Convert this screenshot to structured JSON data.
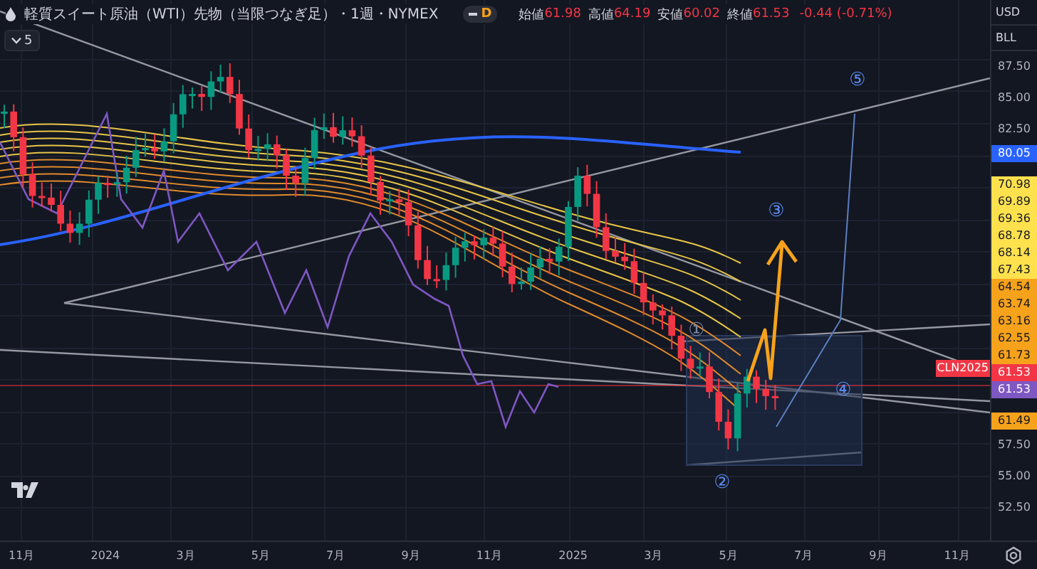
{
  "header": {
    "title": "軽質スイート原油（WTI）先物（当限つなぎ足）・1週・NYMEX",
    "mode_badge": "D",
    "ohlc": [
      {
        "label": "始値",
        "value": "61.98"
      },
      {
        "label": "高値",
        "value": "64.19"
      },
      {
        "label": "安値",
        "value": "60.02"
      },
      {
        "label": "終値",
        "value": "61.53"
      }
    ],
    "change": "-0.44 (-0.71%)"
  },
  "indicator_toggle": {
    "label": "5"
  },
  "currency": [
    "USD",
    "BLL"
  ],
  "price_axis": [
    {
      "kind": "tick",
      "label": "87.50"
    },
    {
      "kind": "tick",
      "label": "85.00"
    },
    {
      "kind": "tick",
      "label": "82.50"
    },
    {
      "kind": "price_badge",
      "label": "80.05",
      "color": "#2962ff"
    },
    {
      "kind": "level_badge",
      "label": "70.98",
      "color": "#ffe14d"
    },
    {
      "kind": "level_badge",
      "label": "69.89",
      "color": "#ffe14d"
    },
    {
      "kind": "level_badge",
      "label": "69.36",
      "color": "#ffe14d"
    },
    {
      "kind": "level_badge",
      "label": "68.78",
      "color": "#ffe14d"
    },
    {
      "kind": "level_badge",
      "label": "68.14",
      "color": "#ffe14d"
    },
    {
      "kind": "level_badge",
      "label": "67.43",
      "color": "#ffe14d"
    },
    {
      "kind": "level_badge",
      "label": "64.54",
      "color": "#f7a21b"
    },
    {
      "kind": "level_badge",
      "label": "63.74",
      "color": "#f7a21b"
    },
    {
      "kind": "level_badge",
      "label": "63.16",
      "color": "#f7a21b"
    },
    {
      "kind": "level_badge",
      "label": "62.55",
      "color": "#f7a21b"
    },
    {
      "kind": "level_badge",
      "label": "61.73",
      "color": "#f7a21b"
    },
    {
      "kind": "price_badge",
      "label": "61.53",
      "color": "#f23645"
    },
    {
      "kind": "price_badge",
      "label": "61.53",
      "color": "#7e57c2"
    },
    {
      "kind": "level_badge",
      "label": "61.49",
      "color": "#f7a21b"
    },
    {
      "kind": "tick",
      "label": "57.50"
    },
    {
      "kind": "tick",
      "label": "55.00"
    },
    {
      "kind": "tick",
      "label": "52.50"
    }
  ],
  "price_tag": {
    "label": "CLN2025"
  },
  "wave_labels": [
    "①",
    "②",
    "③",
    "④",
    "⑤"
  ],
  "time_axis": [
    "11月",
    "2024",
    "3月",
    "5月",
    "7月",
    "9月",
    "11月",
    "2025",
    "3月",
    "5月",
    "7月",
    "9月",
    "11月"
  ]
}
